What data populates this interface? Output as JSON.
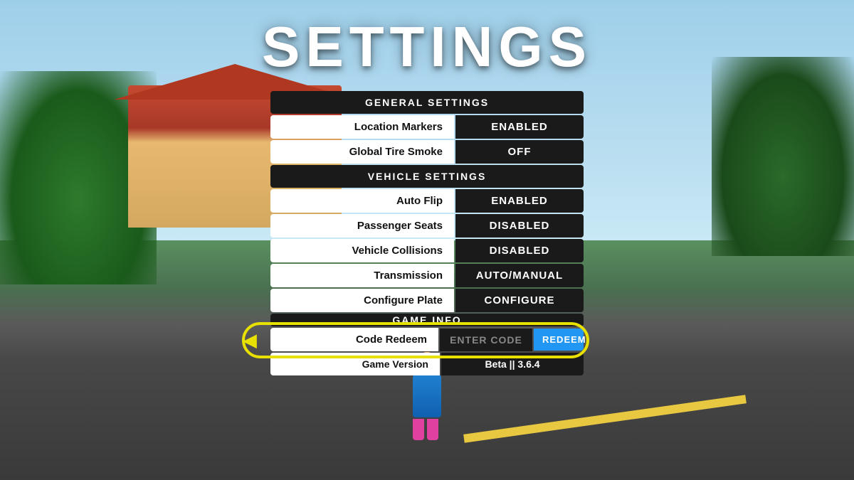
{
  "page": {
    "title": "SETTINGS"
  },
  "sections": {
    "general": {
      "header": "GENERAL SETTINGS",
      "items": [
        {
          "label": "Location Markers",
          "value": "ENABLED"
        },
        {
          "label": "Global Tire Smoke",
          "value": "OFF"
        }
      ]
    },
    "vehicle": {
      "header": "VEHICLE SETTINGS",
      "items": [
        {
          "label": "Auto Flip",
          "value": "ENABLED"
        },
        {
          "label": "Passenger Seats",
          "value": "DISABLED"
        },
        {
          "label": "Vehicle Collisions",
          "value": "DISABLED"
        },
        {
          "label": "Transmission",
          "value": "AUTO/MANUAL"
        },
        {
          "label": "Configure Plate",
          "value": "CONFIGURE"
        }
      ]
    },
    "gameInfo": {
      "header": "GAME INFO",
      "codeRedeem": {
        "label": "Code Redeem",
        "placeholder": "ENTER CODE",
        "buttonLabel": "REDEEM"
      },
      "gameVersion": {
        "label": "Game Version",
        "value": "Beta || 3.6.4"
      }
    }
  },
  "colors": {
    "accent_yellow": "#e8e000",
    "accent_blue": "#2196f3",
    "panel_bg": "#1a1a1a",
    "label_bg": "#ffffff",
    "text_white": "#ffffff",
    "text_dark": "#111111",
    "text_gray": "#888888"
  }
}
